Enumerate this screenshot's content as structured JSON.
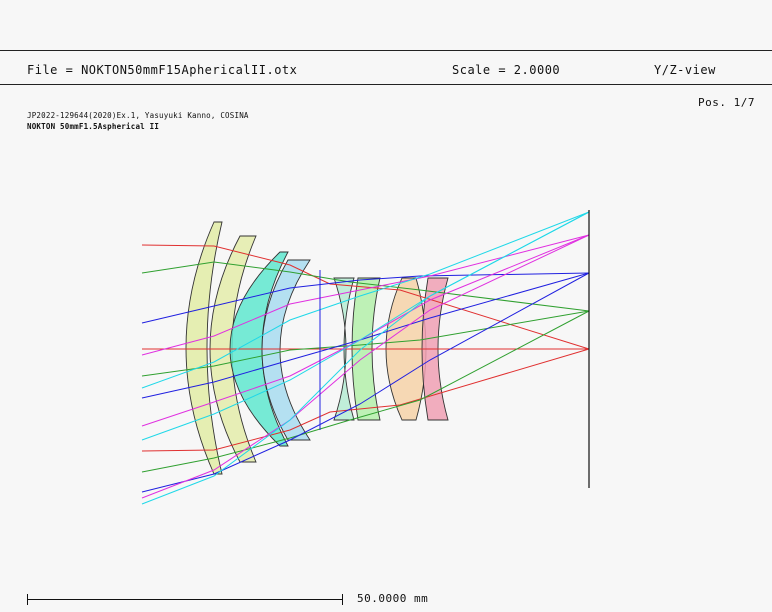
{
  "header": {
    "file": "File = NOKTON50mmF15AphericalII.otx",
    "scale": "Scale = 2.0000",
    "view": "Y/Z-view"
  },
  "position": "Pos. 1/7",
  "info": {
    "line1": "JP2022-129644(2020)Ex.1, Yasuyuki Kanno, COSINA",
    "line2": "NOKTON 50mmF1.5Aspherical II"
  },
  "scale_bar": {
    "label": "50.0000 mm"
  },
  "colors": {
    "element1": "#e2eca6",
    "element2": "#e4ecaa",
    "element3": "#5fe8cf",
    "element4": "#a8dcf0",
    "element5": "#b6ecd4",
    "element6": "#b4f0aa",
    "element7": "#f6d2a8",
    "element8": "#f0a0b4",
    "ray_red": "#e03030",
    "ray_green": "#30a030",
    "ray_blue": "#2020e0",
    "ray_magenta": "#e030e0",
    "ray_cyan": "#20d8e8"
  }
}
